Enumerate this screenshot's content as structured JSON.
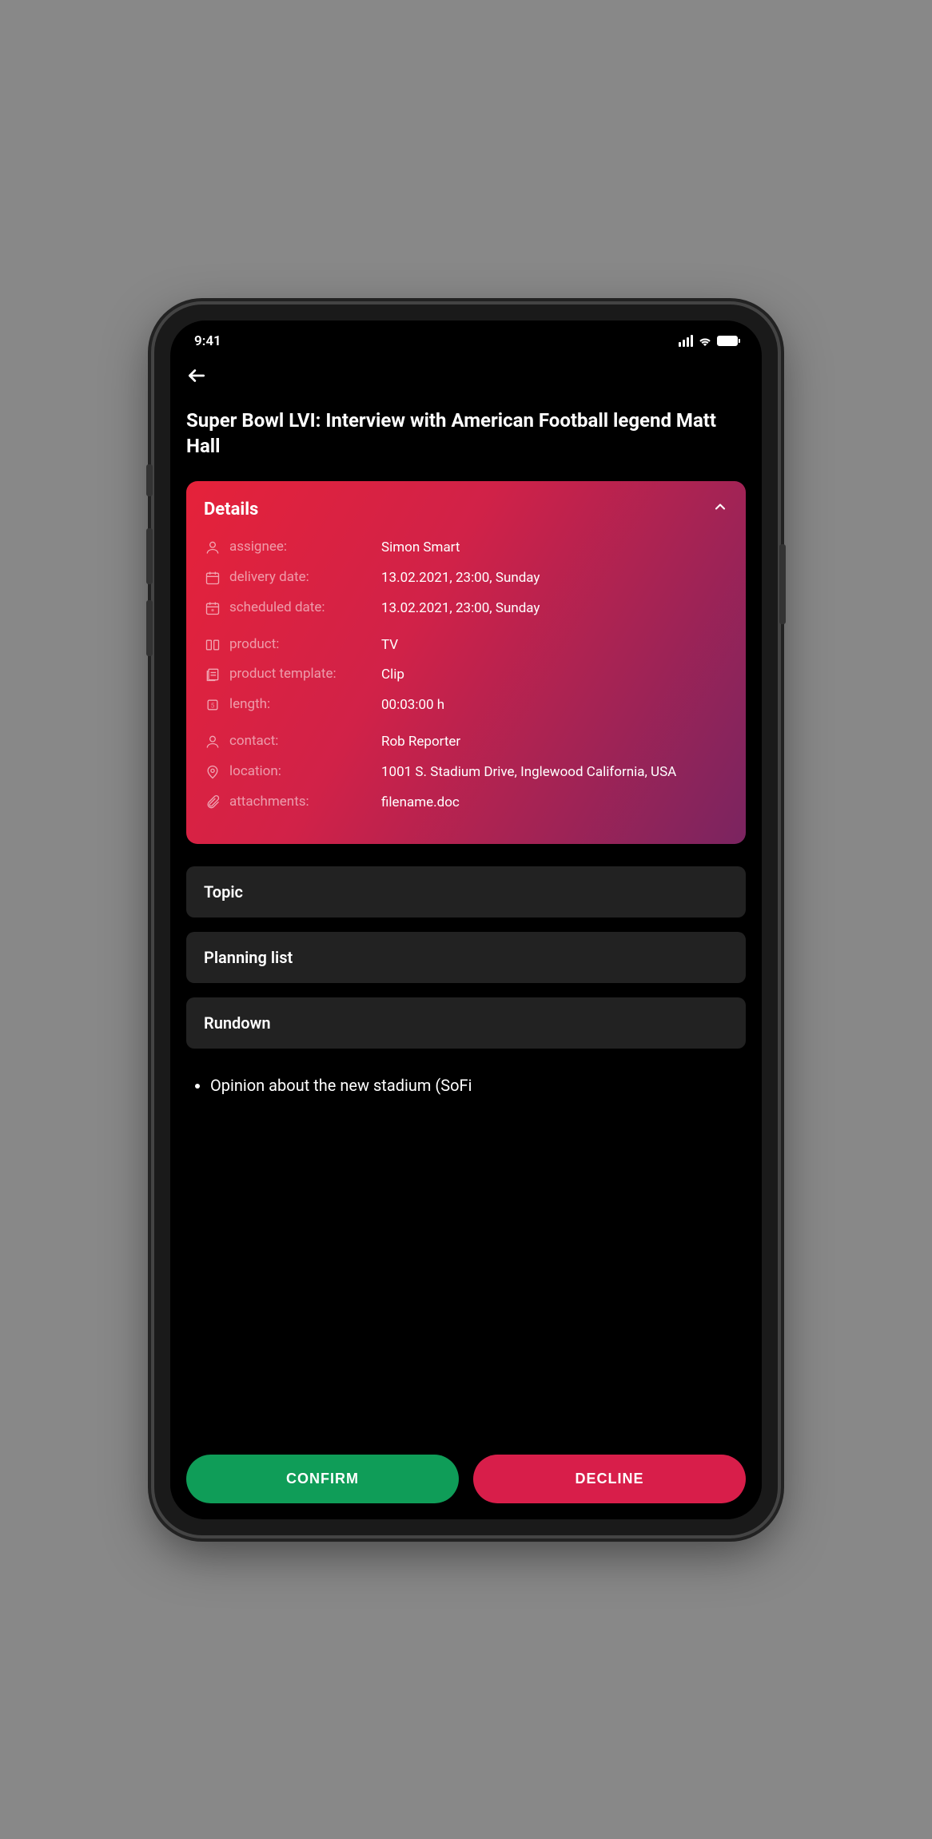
{
  "status": {
    "time": "9:41"
  },
  "page": {
    "title": "Super Bowl LVI: Interview with American Football legend Matt Hall"
  },
  "details": {
    "heading": "Details",
    "rows": {
      "assignee": {
        "label": "assignee:",
        "value": "Simon Smart"
      },
      "delivery_date": {
        "label": "delivery date:",
        "value": "13.02.2021, 23:00, Sunday"
      },
      "scheduled_date": {
        "label": "scheduled date:",
        "value": "13.02.2021, 23:00, Sunday"
      },
      "product": {
        "label": "product:",
        "value": "TV"
      },
      "product_template": {
        "label": "product template:",
        "value": "Clip"
      },
      "length": {
        "label": "length:",
        "value": "00:03:00 h"
      },
      "contact": {
        "label": "contact:",
        "value": "Rob Reporter"
      },
      "location": {
        "label": "location:",
        "value": "1001 S. Stadium Drive, Inglewood California, USA"
      },
      "attachments": {
        "label": "attachments:",
        "value": "filename.doc"
      }
    }
  },
  "sections": {
    "topic": "Topic",
    "planning_list": "Planning list",
    "rundown": "Rundown"
  },
  "notes": {
    "item1": "Opinion about the new stadium (SoFi"
  },
  "actions": {
    "confirm": "CONFIRM",
    "decline": "DECLINE"
  }
}
